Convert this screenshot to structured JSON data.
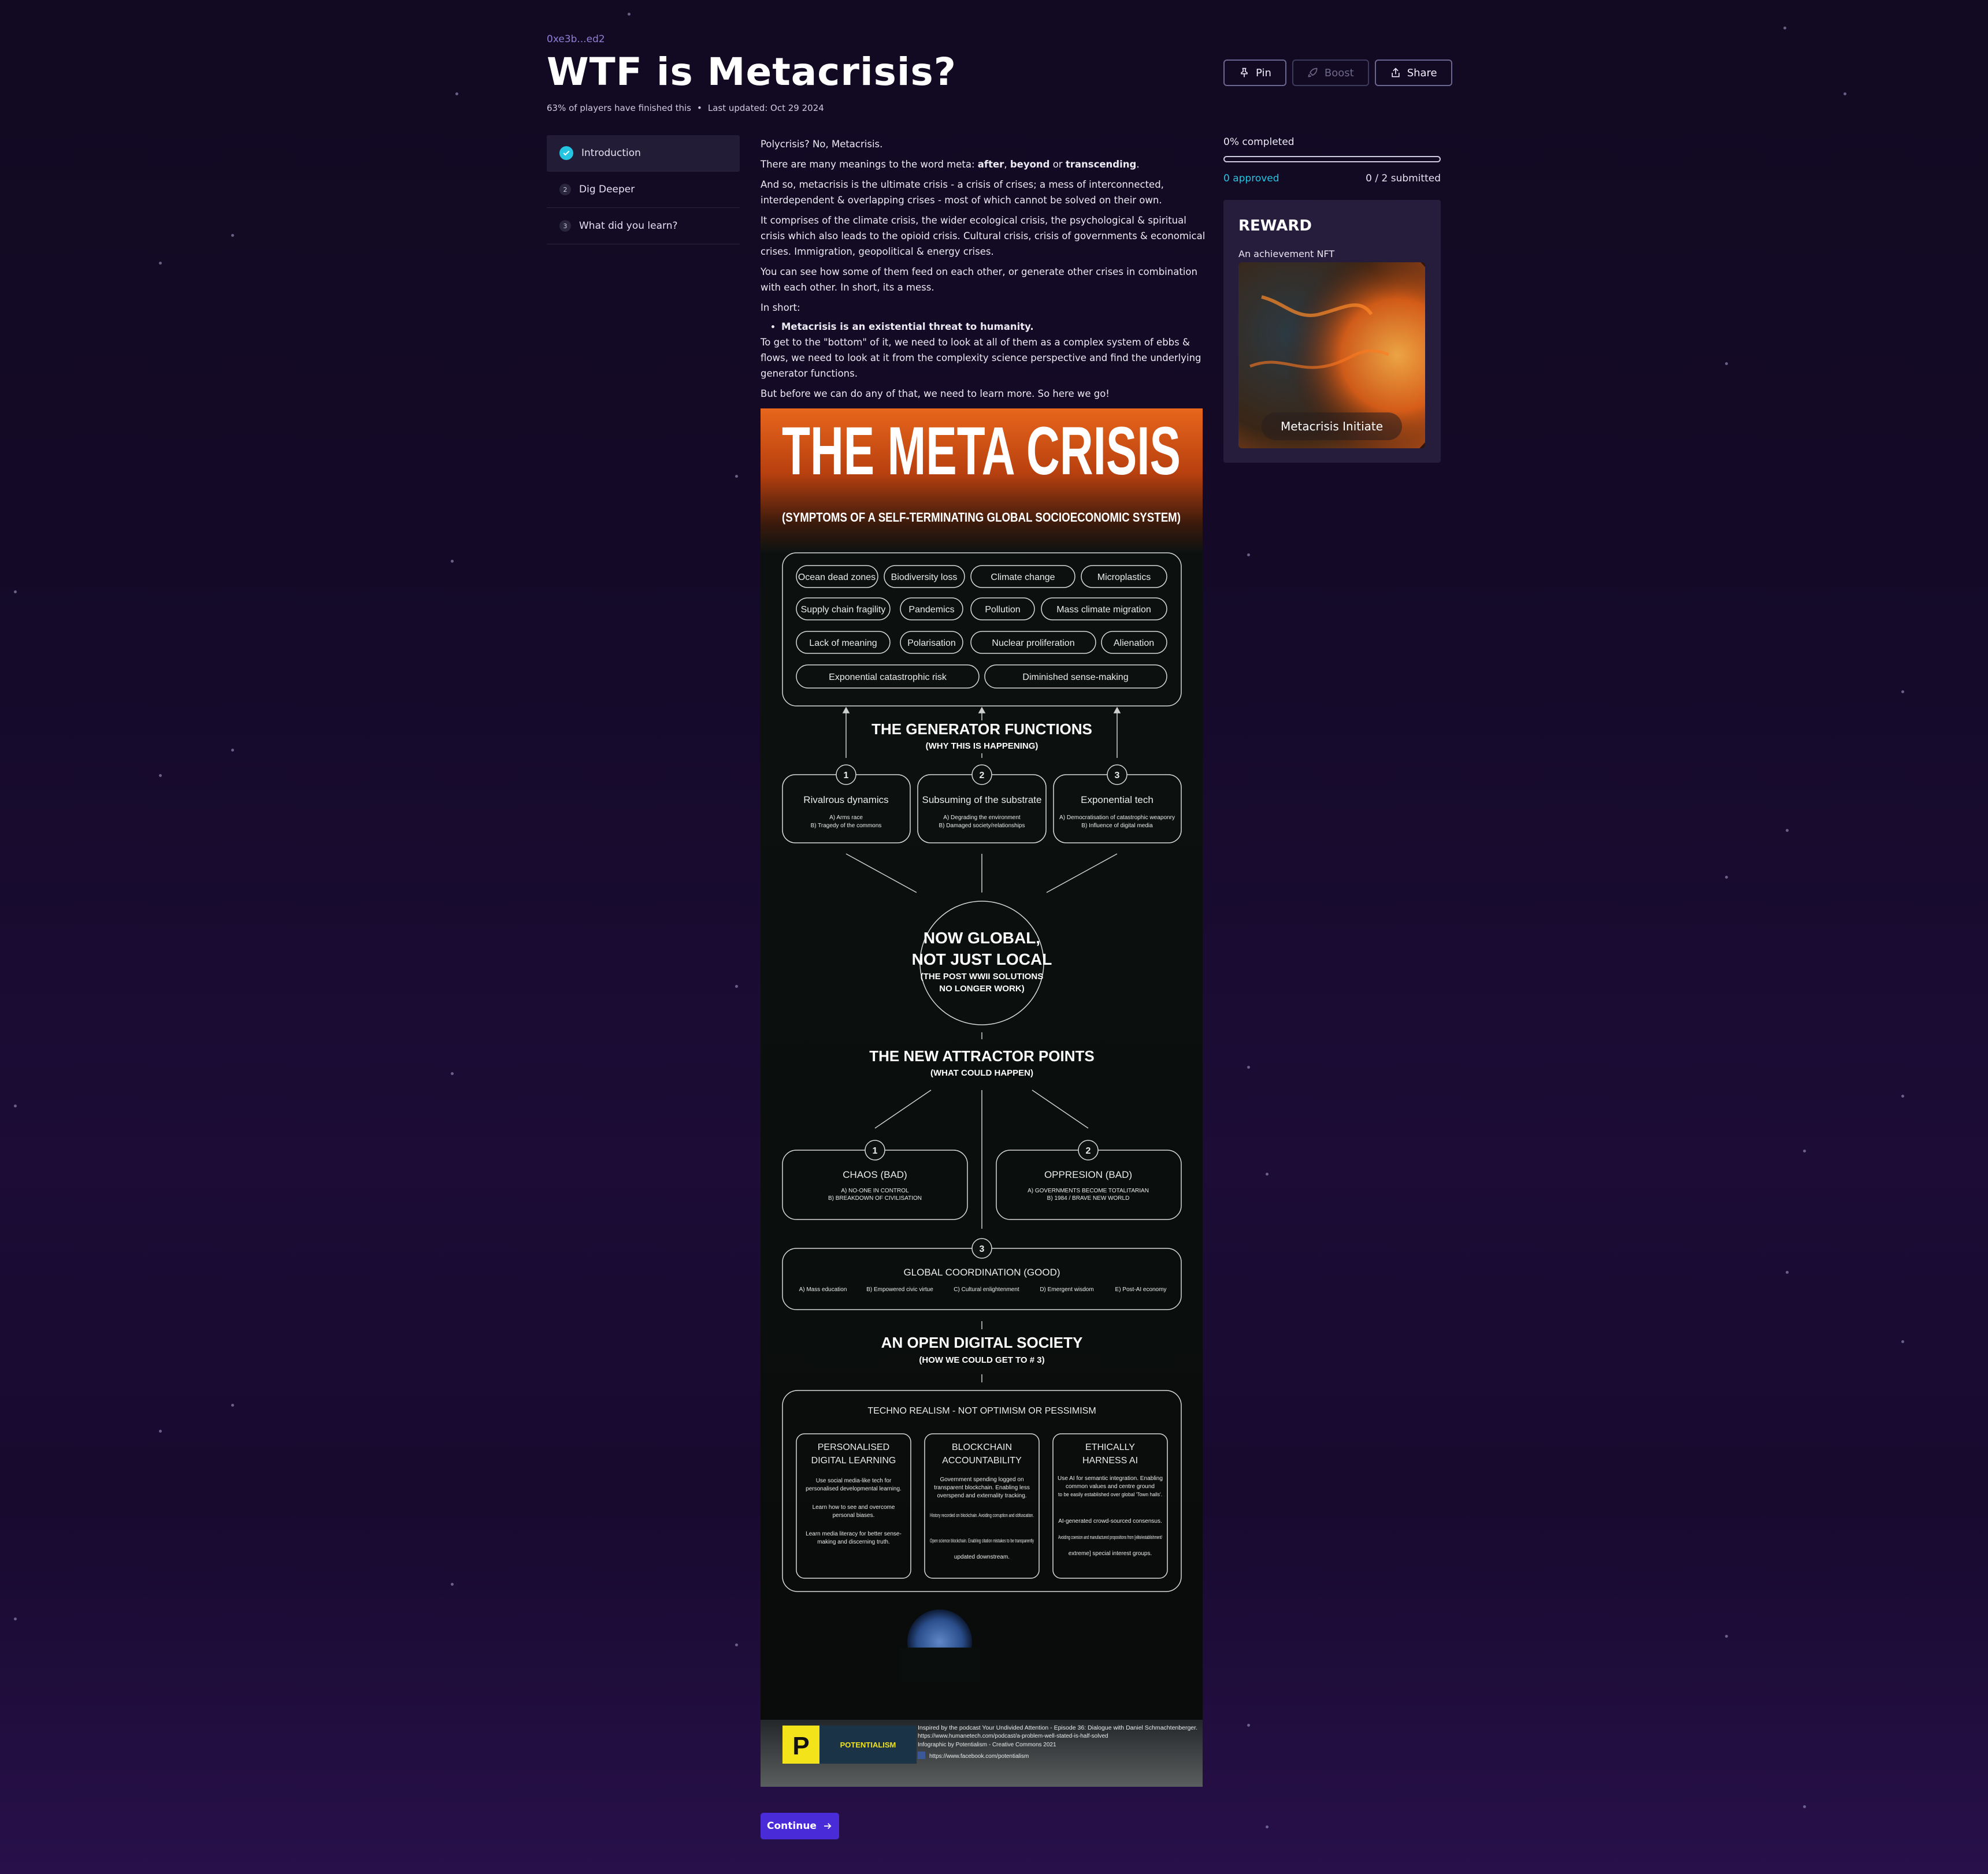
{
  "quest": {
    "address": "0xe3b...ed2",
    "title": "WTF is Metacrisis?",
    "players_finished": "63% of players have finished this",
    "last_updated": "Last updated: Oct 29 2024"
  },
  "actions": {
    "pin": "Pin",
    "boost": "Boost",
    "share": "Share"
  },
  "steps": [
    {
      "index": "1",
      "label": "Introduction",
      "done": true
    },
    {
      "index": "2",
      "label": "Dig Deeper",
      "done": false
    },
    {
      "index": "3",
      "label": "What did you learn?",
      "done": false
    }
  ],
  "content": {
    "p1": "Polycrisis? No, Metacrisis.",
    "p2_prefix": "There are many meanings to the word meta: ",
    "p2_after": "after",
    "p2_sep1": ", ",
    "p2_beyond": "beyond",
    "p2_sep2": " or ",
    "p2_transcending": "transcending",
    "p2_end": ".",
    "p3": "And so, metacrisis is the ultimate crisis - a crisis of crises; a mess of interconnected, interdependent & overlapping crises - most of which cannot be solved on their own.",
    "p4": "It comprises of the climate crisis, the wider ecological crisis, the psychological & spiritual crisis which also leads to the opioid crisis. Cultural crisis, crisis of governments & economical crises. Immigration, geopolitical & energy crises.",
    "p5": "You can see how some of them feed on each other, or generate other crises in combination with each other. In short, its a mess.",
    "p6": "In short:",
    "bullet": "Metacrisis is an existential threat to humanity.",
    "p7": "To get to the \"bottom\" of it, we need to look at all of them as a complex system of ebbs & flows, we need to look at it from the complexity science perspective and find the underlying generator functions.",
    "p8": "But before we can do any of that, we need to learn more. So here we go!"
  },
  "infographic": {
    "title": "THE META CRISIS",
    "subtitle": "(SYMPTOMS OF A SELF-TERMINATING GLOBAL SOCIOECONOMIC SYSTEM)",
    "symptoms": [
      "Ocean dead zones",
      "Biodiversity loss",
      "Climate change",
      "Microplastics",
      "Supply chain fragility",
      "Pandemics",
      "Pollution",
      "Mass climate migration",
      "Lack of meaning",
      "Polarisation",
      "Nuclear proliferation",
      "Alienation",
      "Exponential catastrophic risk",
      "Diminished sense-making"
    ],
    "gen_title": "THE GENERATOR FUNCTIONS",
    "gen_sub": "(WHY THIS IS HAPPENING)",
    "generators": [
      {
        "n": "1",
        "name": "Rivalrous dynamics",
        "a": "A) Arms race",
        "b": "B) Tragedy of the commons"
      },
      {
        "n": "2",
        "name": "Subsuming of the substrate",
        "a": "A) Degrading the environment",
        "b": "B) Damaged society/relationships"
      },
      {
        "n": "3",
        "name": "Exponential tech",
        "a": "A) Democratisation of catastrophic weaponry",
        "b": "B) Influence of digital media"
      }
    ],
    "global_1": "NOW GLOBAL,",
    "global_2": "NOT JUST LOCAL",
    "global_3": "(THE POST WWII SOLUTIONS",
    "global_4": "NO LONGER WORK)",
    "attr_title": "THE NEW ATTRACTOR POINTS",
    "attr_sub": "(WHAT COULD HAPPEN)",
    "chaos": {
      "n": "1",
      "name": "CHAOS (BAD)",
      "a": "A) NO-ONE IN CONTROL",
      "b": "B) BREAKDOWN OF CIVILISATION"
    },
    "oppression": {
      "n": "2",
      "name": "OPPRESION (BAD)",
      "a": "A) GOVERNMENTS BECOME TOTALITARIAN",
      "b": "B) 1984 / BRAVE NEW WORLD"
    },
    "coord": {
      "n": "3",
      "name": "GLOBAL COORDINATION (GOOD)",
      "items": [
        "A) Mass education",
        "B) Empowered civic virtue",
        "C) Cultural enlightenment",
        "D) Emergent wisdom",
        "E) Post-AI economy"
      ]
    },
    "open_title": "AN OPEN DIGITAL SOCIETY",
    "open_sub": "(HOW WE COULD GET TO # 3)",
    "techno": "TECHNO REALISM - NOT OPTIMISM OR PESSIMISM",
    "cols": [
      {
        "t1": "PERSONALISED",
        "t2": "DIGITAL LEARNING",
        "l1": "Use social media-like tech for",
        "l2": "personalised developmental learning.",
        "l3": "Learn how to see and overcome",
        "l4": "personal biases.",
        "l5": "Learn media literacy for better sense-",
        "l6": "making and discerning truth."
      },
      {
        "t1": "BLOCKCHAIN",
        "t2": "ACCOUNTABILITY",
        "l1": "Government spending logged on",
        "l2": "transparent blockchain. Enabling less",
        "l3": "overspend and externality tracking.",
        "l4": "History recorded on blockchain. Avoiding corruption and obfuscation.",
        "l5": "Open science blockchain. Enabling citation mistakes to be transparently",
        "l6": "updated downstream."
      },
      {
        "t1": "ETHICALLY",
        "t2": "HARNESS AI",
        "l1": "Use AI for semantic integration. Enabling",
        "l2": "common values and centre ground",
        "l3": "to be easily established over global 'Town halls'.",
        "l4": "AI-generated crowd-sourced consensus.",
        "l5": "Avoiding coersion and manufactured propositions from [elite/establishment/",
        "l6": "extreme] special interest groups."
      }
    ],
    "brand": "POTENTIALISM",
    "credit1": "Inspired by the podcast Your Undivided Attention - Episode 36: Dialogue with Daniel Schmachtenberger.",
    "credit2": "https://www.humanetech.com/podcast/a-problem-well-stated-is-half-solved",
    "credit3": "Infographic by Potentialism - Creative Commons 2021",
    "credit4": "https://www.facebook.com/potentialism"
  },
  "continue_label": "Continue",
  "progress": {
    "completed": "0% completed",
    "approved": "0 approved",
    "submitted": "0 / 2 submitted"
  },
  "reward": {
    "heading": "REWARD",
    "subtitle": "An achievement NFT",
    "nft_name": "Metacrisis Initiate"
  },
  "colors": {
    "accent": "#4a2bd8",
    "cyan": "#27c6e0",
    "orange": "#e8661c"
  }
}
